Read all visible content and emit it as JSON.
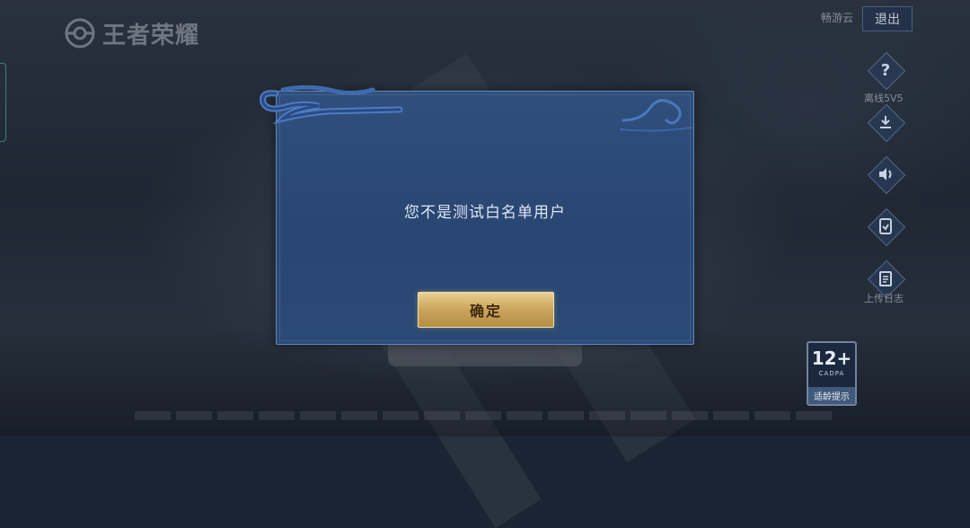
{
  "app": {
    "logo_text": "王者荣耀"
  },
  "header": {
    "region": "畅游云",
    "exit_label": "退出"
  },
  "side_menu": {
    "items": [
      {
        "icon": "question-icon",
        "label": "离线5V5"
      },
      {
        "icon": "download-icon",
        "label": ""
      },
      {
        "icon": "volume-icon",
        "label": ""
      },
      {
        "icon": "repair-icon",
        "label": ""
      },
      {
        "icon": "clipboard-icon",
        "label": "上传日志"
      }
    ]
  },
  "age_rating": {
    "value": "12+",
    "org": "CADPA",
    "tip": "适龄提示"
  },
  "dialog": {
    "message": "您不是测试白名单用户",
    "confirm_label": "确定"
  },
  "colors": {
    "dialog_bg": "#2c4a76",
    "confirm_gold": "#c9a45a"
  }
}
